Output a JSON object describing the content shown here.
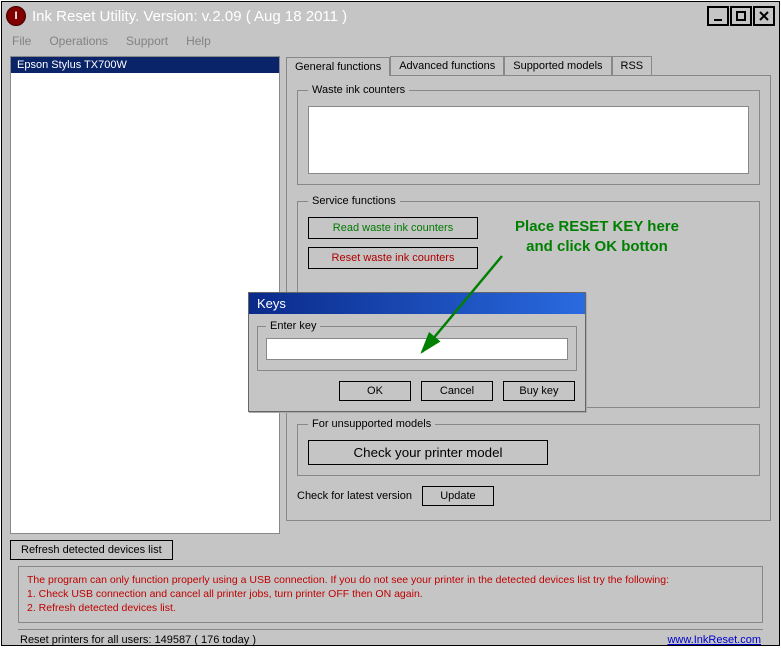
{
  "titlebar": {
    "icon_letter": "I",
    "title": "Ink Reset Utility. Version: v.2.09 ( Aug 18 2011 )"
  },
  "menu": {
    "file": "File",
    "operations": "Operations",
    "support": "Support",
    "help": "Help"
  },
  "devices": {
    "selected": "Epson Stylus TX700W",
    "refresh_label": "Refresh detected devices list"
  },
  "tabs": {
    "general": "General functions",
    "advanced": "Advanced functions",
    "supported": "Supported models",
    "rss": "RSS"
  },
  "general": {
    "waste_legend": "Waste ink counters",
    "service_legend": "Service functions",
    "read_btn": "Read waste ink counters",
    "reset_btn": "Reset waste ink counters",
    "unsupported_legend": "For unsupported models",
    "check_model_btn": "Check your printer model",
    "check_version_label": "Check for latest version",
    "update_btn": "Update"
  },
  "dialog": {
    "title": "Keys",
    "enter_legend": "Enter key",
    "key_value": "",
    "ok": "OK",
    "cancel": "Cancel",
    "buy": "Buy key"
  },
  "annotation": {
    "line1": "Place RESET KEY here",
    "line2": "and click OK botton"
  },
  "info": {
    "line1": "The program can only function properly using a USB connection. If you do not see your printer in the detected devices list try the following:",
    "line2": "1. Check USB connection and cancel all printer jobs, turn printer OFF then ON again.",
    "line3": "2. Refresh detected devices list."
  },
  "status": {
    "text": "Reset printers for all users: 149587 ( 176 today )",
    "link": "www.InkReset.com"
  }
}
